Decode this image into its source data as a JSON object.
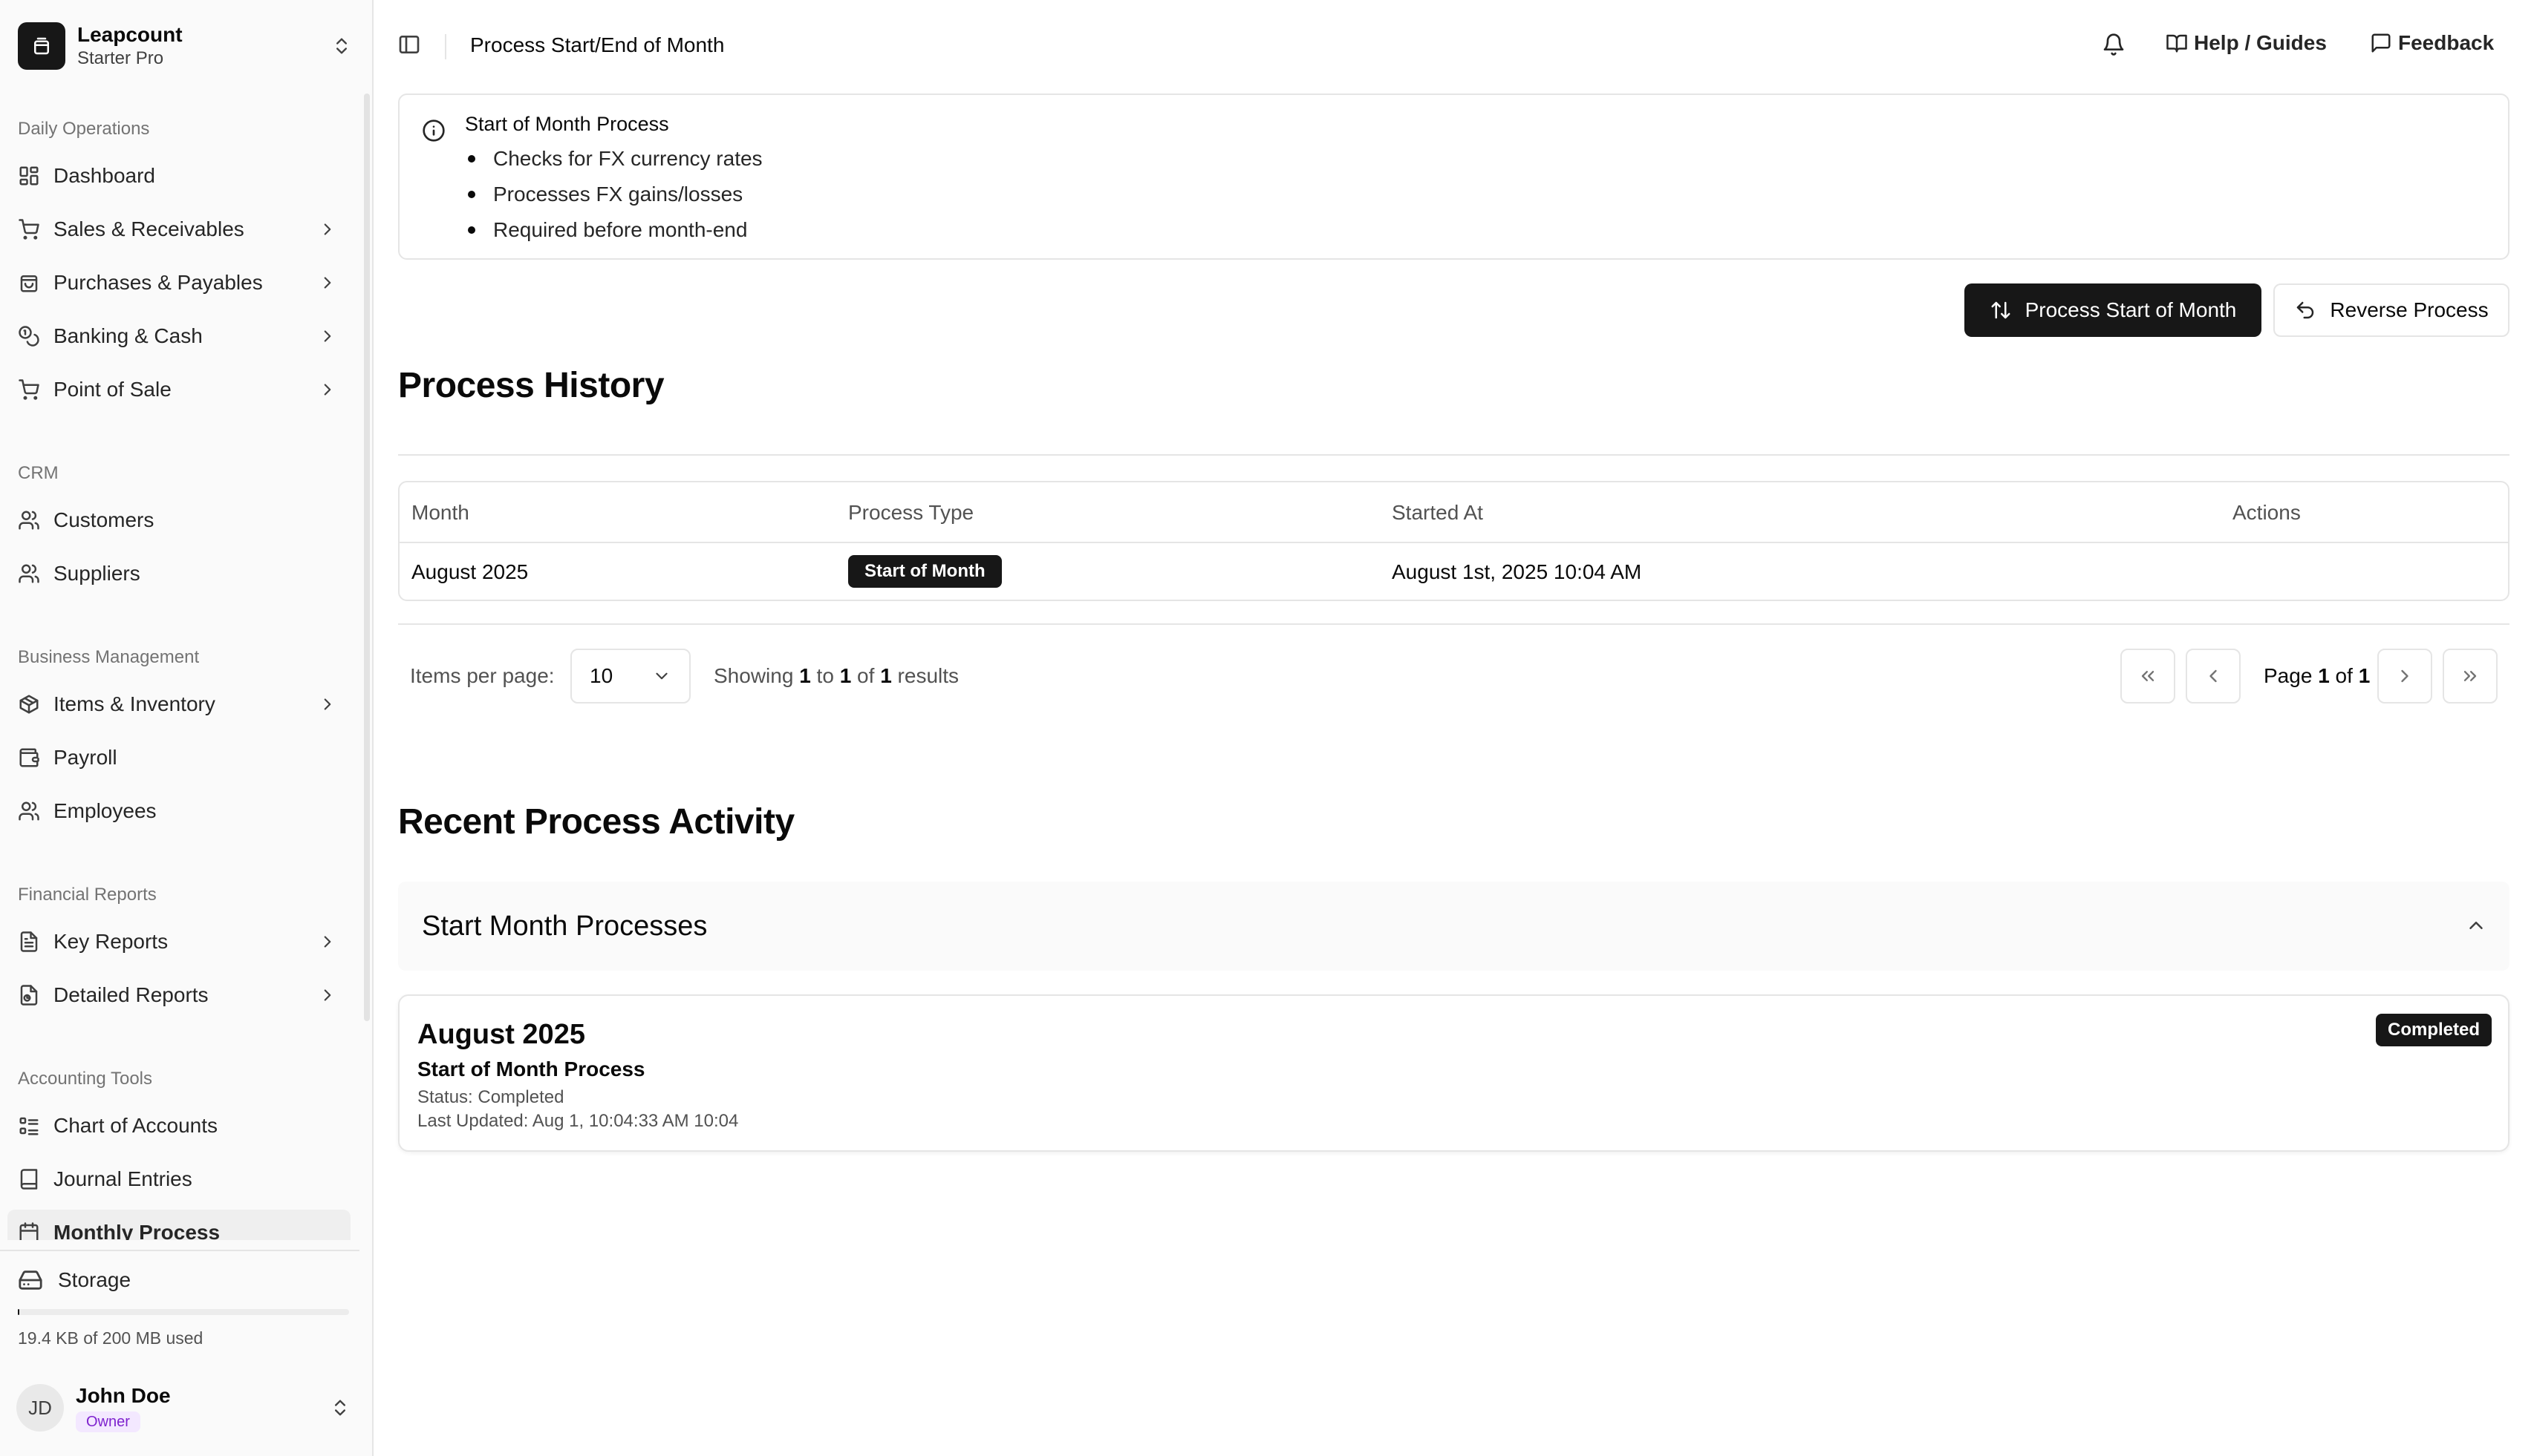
{
  "app": {
    "name": "Leapcount",
    "plan": "Starter Pro"
  },
  "sidebar": {
    "groups": [
      {
        "label": "Daily Operations",
        "items": [
          {
            "label": "Dashboard",
            "icon": "dashboard-icon"
          },
          {
            "label": "Sales & Receivables",
            "icon": "cart-icon"
          },
          {
            "label": "Purchases & Payables",
            "icon": "shopping-bag-icon"
          },
          {
            "label": "Banking & Cash",
            "icon": "coins-icon"
          },
          {
            "label": "Point of Sale",
            "icon": "cart-icon"
          }
        ]
      },
      {
        "label": "CRM",
        "items": [
          {
            "label": "Customers",
            "icon": "users-icon"
          },
          {
            "label": "Suppliers",
            "icon": "users-icon"
          }
        ]
      },
      {
        "label": "Business Management",
        "items": [
          {
            "label": "Items & Inventory",
            "icon": "package-icon"
          },
          {
            "label": "Payroll",
            "icon": "wallet-icon"
          },
          {
            "label": "Employees",
            "icon": "users-icon"
          }
        ]
      },
      {
        "label": "Financial Reports",
        "items": [
          {
            "label": "Key Reports",
            "icon": "file-text-icon"
          },
          {
            "label": "Detailed Reports",
            "icon": "file-chart-icon"
          }
        ]
      },
      {
        "label": "Accounting Tools",
        "items": [
          {
            "label": "Chart of Accounts",
            "icon": "list-tree-icon"
          },
          {
            "label": "Journal Entries",
            "icon": "book-icon"
          },
          {
            "label": "Monthly Process",
            "icon": "calendar-icon"
          }
        ]
      }
    ],
    "storage": {
      "label": "Storage",
      "used_text": "19.4 KB of 200 MB used",
      "used_fraction": 0.0001
    },
    "user": {
      "initials": "JD",
      "name": "John Doe",
      "role": "Owner"
    }
  },
  "topbar": {
    "title": "Process Start/End of Month",
    "help_label": "Help / Guides",
    "feedback_label": "Feedback"
  },
  "info": {
    "title": "Start of Month Process",
    "bullets": [
      "Checks for FX currency rates",
      "Processes FX gains/losses",
      "Required before month-end"
    ]
  },
  "actions": {
    "primary_label": "Process Start of Month",
    "secondary_label": "Reverse Process"
  },
  "history": {
    "title": "Process History",
    "columns": [
      "Month",
      "Process Type",
      "Started At",
      "Actions"
    ],
    "rows": [
      {
        "month": "August 2025",
        "process_type": "Start of Month",
        "started_at": "August 1st, 2025 10:04 AM",
        "actions": ""
      }
    ],
    "pagination": {
      "items_per_page_label": "Items per page:",
      "items_per_page": "10",
      "showing_prefix": "Showing",
      "from": "1",
      "to_word": "to",
      "to": "1",
      "of_word": "of",
      "total": "1",
      "results_word": "results",
      "page_word": "Page",
      "page": "1",
      "page_of_word": "of",
      "page_total": "1"
    }
  },
  "activity": {
    "title": "Recent Process Activity",
    "section_label": "Start Month Processes",
    "card": {
      "period": "August 2025",
      "name": "Start of Month Process",
      "status": "Status: Completed",
      "updated": "Last Updated: Aug 1, 10:04:33 AM 10:04",
      "badge": "Completed"
    }
  }
}
